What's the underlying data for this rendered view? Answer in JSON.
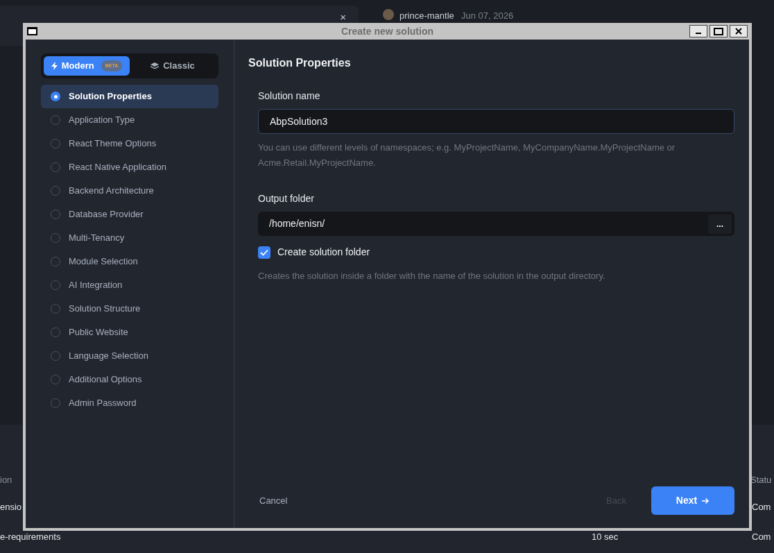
{
  "background": {
    "author": "prince-mantle",
    "date": "Jun 07, 2026",
    "close": "×",
    "table": {
      "header": [
        "ion",
        "Statu"
      ],
      "rows": [
        {
          "cells": [
            "ensio",
            "",
            "Com"
          ]
        },
        {
          "cells": [
            "e-requirements",
            "10 sec",
            "Com"
          ]
        }
      ]
    }
  },
  "window": {
    "title": "Create new solution"
  },
  "mode_tabs": [
    {
      "label": "Modern",
      "badge": "BETA",
      "selected": true
    },
    {
      "label": "Classic",
      "selected": false
    }
  ],
  "steps": [
    {
      "label": "Solution Properties",
      "selected": true
    },
    {
      "label": "Application Type",
      "selected": false
    },
    {
      "label": "React Theme Options",
      "selected": false
    },
    {
      "label": "React Native Application",
      "selected": false
    },
    {
      "label": "Backend Architecture",
      "selected": false
    },
    {
      "label": "Database Provider",
      "selected": false
    },
    {
      "label": "Multi-Tenancy",
      "selected": false
    },
    {
      "label": "Module Selection",
      "selected": false
    },
    {
      "label": "AI Integration",
      "selected": false
    },
    {
      "label": "Solution Structure",
      "selected": false
    },
    {
      "label": "Public Website",
      "selected": false
    },
    {
      "label": "Language Selection",
      "selected": false
    },
    {
      "label": "Additional Options",
      "selected": false
    },
    {
      "label": "Admin Password",
      "selected": false
    }
  ],
  "content": {
    "heading": "Solution Properties",
    "solution_name": {
      "label": "Solution name",
      "value": "AbpSolution3",
      "help": "You can use different levels of namespaces; e.g. MyProjectName, MyCompanyName.MyProjectName or Acme.Retail.MyProjectName."
    },
    "output_folder": {
      "label": "Output folder",
      "value": "/home/enisn/",
      "browse": "..."
    },
    "create_folder": {
      "label": "Create solution folder",
      "checked": true,
      "help": "Creates the solution inside a folder with the name of the solution in the output directory."
    }
  },
  "footer": {
    "cancel": "Cancel",
    "back": {
      "label": "Back",
      "disabled": true
    },
    "next": "Next"
  }
}
